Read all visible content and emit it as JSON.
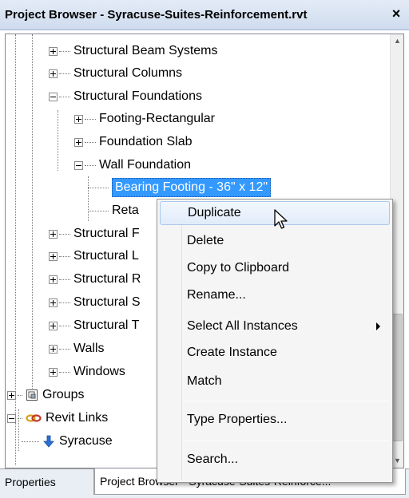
{
  "window": {
    "title": "Project Browser - Syracuse-Suites-Reinforcement.rvt",
    "close_glyph": "×"
  },
  "tree": {
    "rows": [
      {
        "label": "Structural Beam Systems",
        "expander": "plus"
      },
      {
        "label": "Structural Columns",
        "expander": "plus"
      },
      {
        "label": "Structural Foundations",
        "expander": "minus"
      },
      {
        "label": "Footing-Rectangular",
        "expander": "plus"
      },
      {
        "label": "Foundation Slab",
        "expander": "plus"
      },
      {
        "label": "Wall Foundation",
        "expander": "minus"
      },
      {
        "label": "Bearing Footing - 36\" x 12\"",
        "selected": true
      },
      {
        "label": "Reta"
      },
      {
        "label": "Structural F",
        "expander": "plus"
      },
      {
        "label": "Structural L",
        "expander": "plus"
      },
      {
        "label": "Structural R",
        "expander": "plus"
      },
      {
        "label": "Structural S",
        "expander": "plus"
      },
      {
        "label": "Structural T",
        "expander": "plus"
      },
      {
        "label": "Walls",
        "expander": "plus"
      },
      {
        "label": "Windows",
        "expander": "plus"
      },
      {
        "label": "Groups",
        "expander": "plus",
        "icon": "groups-icon"
      },
      {
        "label": "Revit Links",
        "expander": "minus",
        "icon": "revit-links-icon"
      },
      {
        "label": "Syracuse",
        "icon": "revit-link-arrow-icon"
      }
    ]
  },
  "context_menu": {
    "items": [
      {
        "label": "Duplicate",
        "hover": true
      },
      {
        "label": "Delete"
      },
      {
        "label": "Copy to Clipboard"
      },
      {
        "label": "Rename..."
      },
      {
        "label": "Select All Instances",
        "submenu": true
      },
      {
        "label": "Create Instance"
      },
      {
        "label": "Match"
      },
      {
        "label": "Type Properties..."
      },
      {
        "label": "Search..."
      }
    ]
  },
  "tabs": [
    {
      "label": "Properties",
      "active": false
    },
    {
      "label": "Project Browser - Syracuse-Suites-Reinforce...",
      "active": true
    }
  ],
  "colors": {
    "selection": "#3399ff",
    "title_bar": "#d6e2f1",
    "menu_background": "#f5f5f5",
    "link_icon": "#d4a017",
    "link_arrow": "#2a6fd6"
  }
}
